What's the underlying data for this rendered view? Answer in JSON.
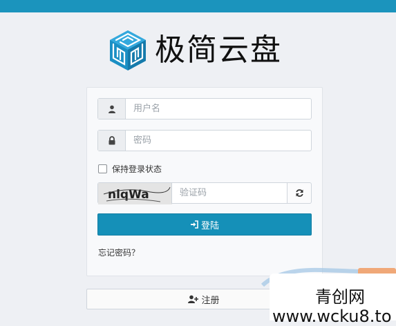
{
  "colors": {
    "accent": "#1590b8",
    "topbar": "#1b94bd"
  },
  "brand": {
    "title": "极简云盘",
    "logo_icon": "cube-maze-icon"
  },
  "login_form": {
    "username_placeholder": "用户名",
    "username_icon": "user-icon",
    "password_placeholder": "密码",
    "password_icon": "lock-icon",
    "remember_label": "保持登录状态",
    "captcha_text": "nlqWa",
    "captcha_placeholder": "验证码",
    "refresh_icon": "refresh-icon",
    "login_label": "登陆",
    "login_icon": "sign-in-icon",
    "forgot_label": "忘记密码？"
  },
  "register": {
    "label": "注册",
    "icon": "user-plus-icon"
  },
  "watermark": {
    "line1": "青创网",
    "line2": "www.wcku8.to"
  }
}
